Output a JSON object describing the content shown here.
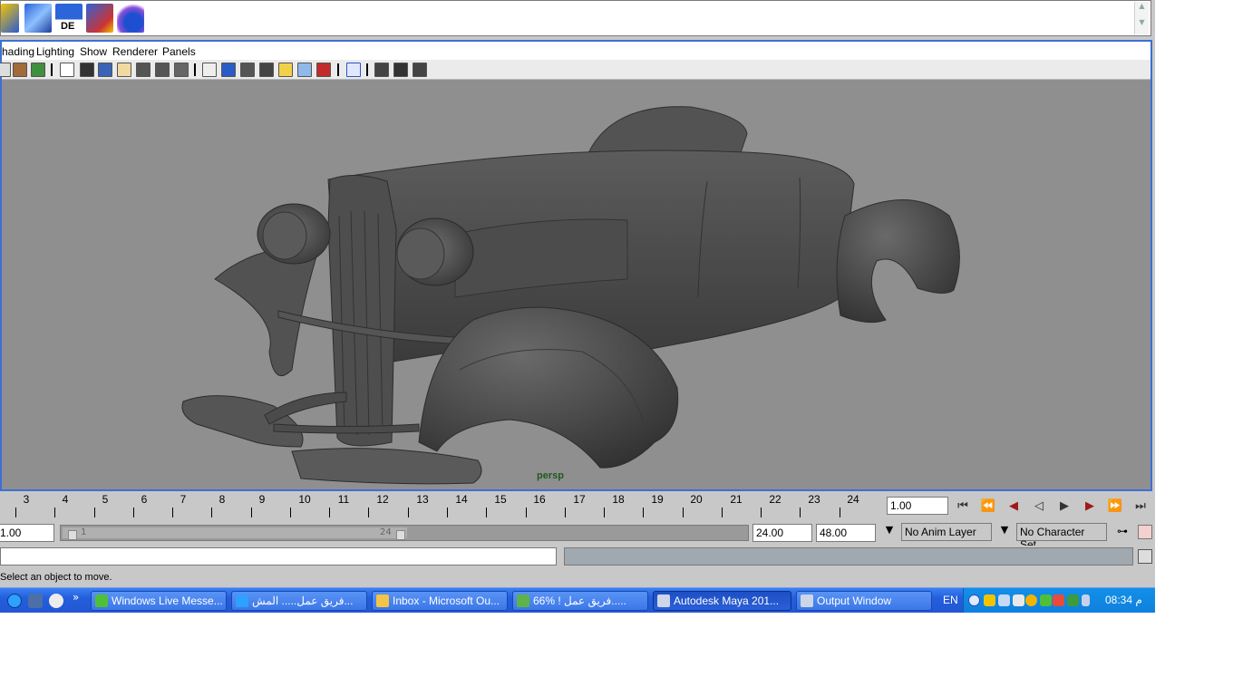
{
  "shelf": {
    "icons": [
      "uv-grid-icon",
      "map-icon",
      "de-uv-icon",
      "select-uv-icon",
      "sphere-render-icon"
    ],
    "de_label": "DE"
  },
  "menu": {
    "items": [
      "hading",
      "Lighting",
      "Show",
      "Renderer",
      "Panels"
    ]
  },
  "viewport": {
    "camera": "persp",
    "background": "#8f8f8f",
    "model": "hot-rod-car"
  },
  "timeline": {
    "ticks": [
      "3",
      "4",
      "5",
      "6",
      "7",
      "8",
      "9",
      "10",
      "11",
      "12",
      "13",
      "14",
      "15",
      "16",
      "17",
      "18",
      "19",
      "20",
      "21",
      "22",
      "23",
      "24"
    ],
    "current_time": "1.00",
    "playback_buttons": [
      "go-to-start",
      "step-back-key",
      "step-back-frame",
      "play-backwards",
      "play-forwards",
      "step-forward-frame",
      "step-forward-key",
      "go-to-end"
    ]
  },
  "range": {
    "start": "1.00",
    "handle_start": "1",
    "handle_end": "24",
    "end": "24.00",
    "anim_end": "48.00",
    "anim_layer": "No Anim Layer",
    "character_set": "No Character Set"
  },
  "status": {
    "help_line": "Select an object to move."
  },
  "taskbar": {
    "tasks": [
      {
        "label": "Windows Live Messe...",
        "active": false
      },
      {
        "label": "فريق عمل..... المش...",
        "active": false
      },
      {
        "label": "Inbox - Microsoft Ou...",
        "active": false
      },
      {
        "label": "66% ! فريق عمل.....",
        "active": false
      },
      {
        "label": "Autodesk Maya 201...",
        "active": true
      },
      {
        "label": "Output Window",
        "active": false
      }
    ],
    "language": "EN",
    "clock": "08:34 م",
    "chevron": "»"
  },
  "colors": {
    "panel_border": "#3d6fd6",
    "taskbar": "#245edb",
    "tray": "#0f7fde",
    "viewport": "#8f8f8f"
  }
}
